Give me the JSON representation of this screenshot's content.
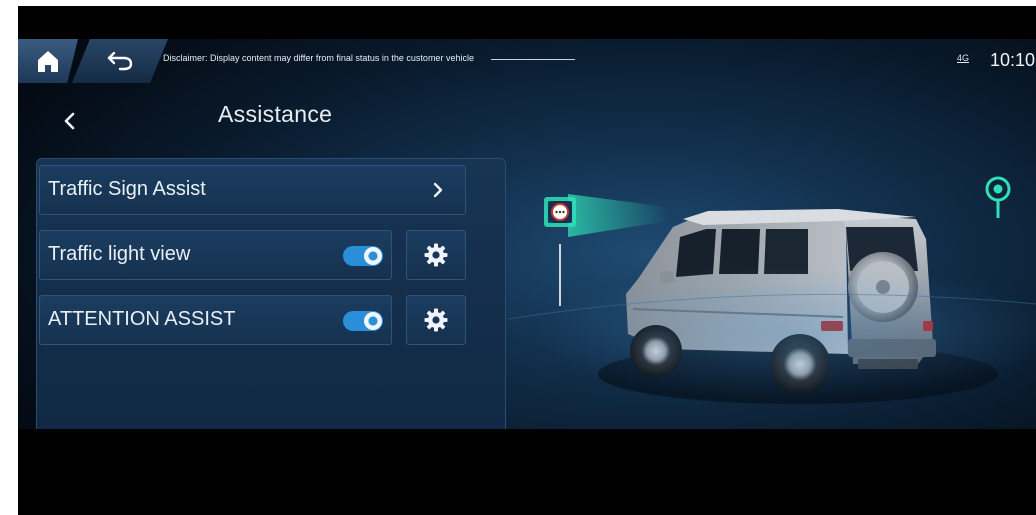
{
  "status_bar": {
    "home_icon": "home-icon",
    "back_icon": "back-arrow-icon",
    "disclaimer": "Disclaimer: Display content may differ from final status in the customer vehicle",
    "network": "4G",
    "time": "10:10"
  },
  "header": {
    "back_icon": "chevron-left-icon",
    "title": "Assistance"
  },
  "settings": {
    "items": [
      {
        "label": "Traffic Sign Assist",
        "control": "chevron-right-icon"
      },
      {
        "label": "Traffic light view",
        "toggle_on": true,
        "settings_icon": "gear-icon"
      },
      {
        "label": "ATTENTION ASSIST",
        "toggle_on": true,
        "settings_icon": "gear-icon"
      }
    ]
  },
  "colors": {
    "accent": "#2a8fd8",
    "highlight": "#2fe0b8",
    "panel": "#163352"
  }
}
